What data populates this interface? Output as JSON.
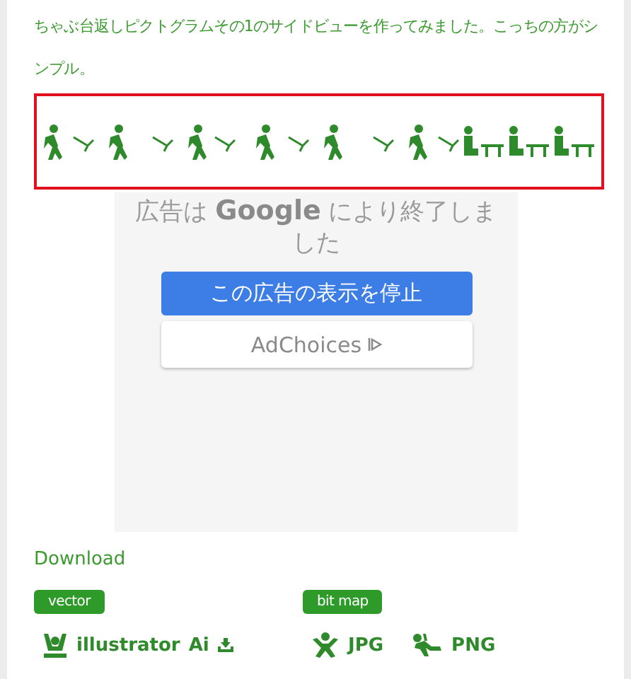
{
  "intro": "ちゃぶ台返しピクトグラムその1のサイドビューを作ってみました。こっちの方がシンプル。",
  "ad": {
    "message": "広告は **Google** により終了しました",
    "stop_button": "この広告の表示を停止",
    "adchoices_button": "AdChoices"
  },
  "download": {
    "heading": "Download",
    "groups": [
      {
        "tag": "vector",
        "links": [
          {
            "kind": "ai",
            "label": "illustrator",
            "suffix": "Ai"
          }
        ]
      },
      {
        "tag": "bit map",
        "links": [
          {
            "kind": "jpg",
            "label": "JPG"
          },
          {
            "kind": "png",
            "label": "PNG"
          }
        ]
      }
    ]
  }
}
